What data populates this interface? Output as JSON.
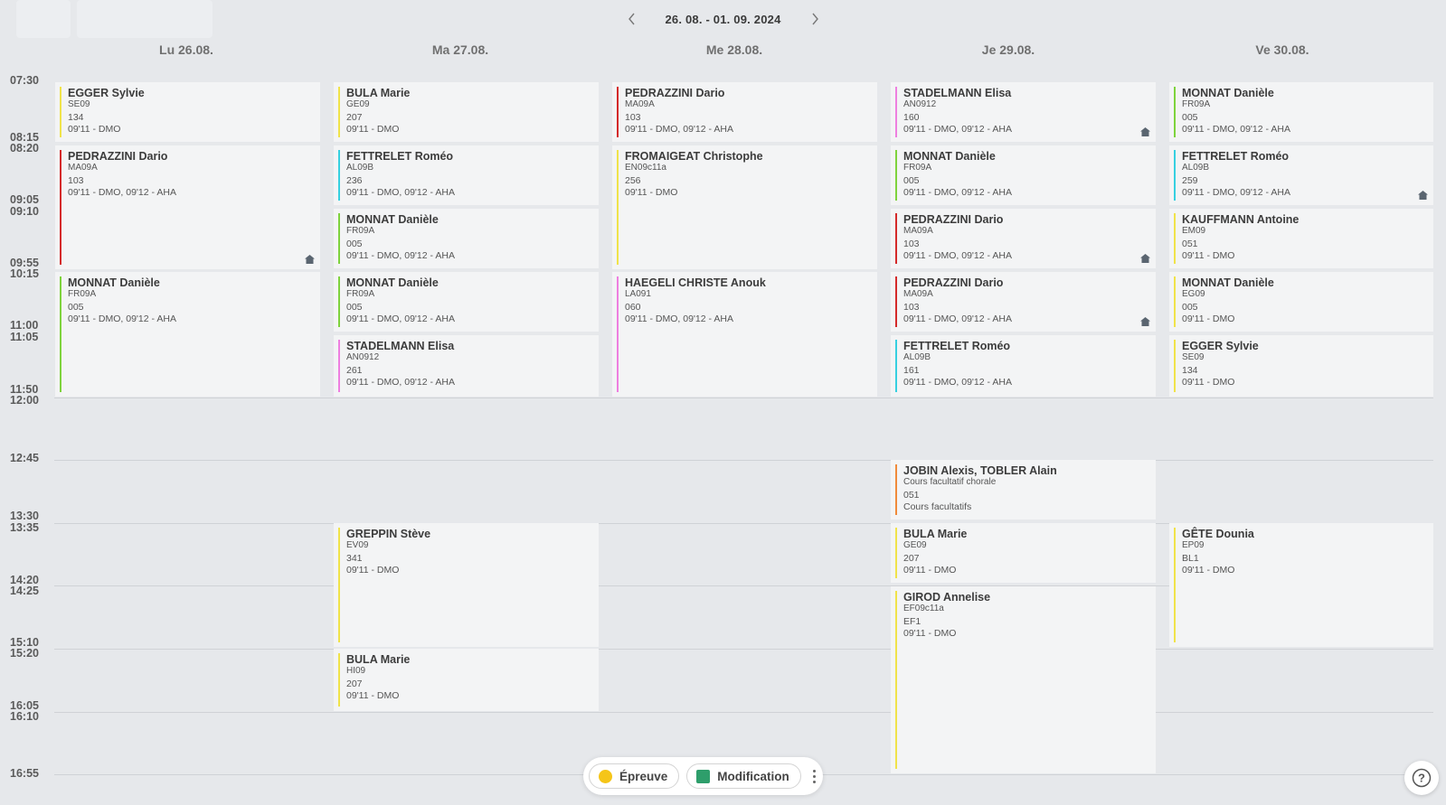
{
  "nav": {
    "date_range": "26. 08. - 01. 09. 2024",
    "prev_icon": "chevron-left-icon",
    "next_icon": "chevron-right-icon"
  },
  "days": [
    "Lu 26.08.",
    "Ma 27.08.",
    "Me 28.08.",
    "Je 29.08.",
    "Ve 30.08."
  ],
  "times": [
    "07:30",
    "08:15",
    "08:20",
    "09:05",
    "09:10",
    "09:55",
    "10:15",
    "11:00",
    "11:05",
    "11:50",
    "12:00",
    "12:45",
    "13:30",
    "13:35",
    "14:20",
    "14:25",
    "15:10",
    "15:20",
    "16:05",
    "16:10",
    "16:55"
  ],
  "colors": {
    "yellow": "#f0e34a",
    "red": "#d42a2a",
    "cyan": "#36d0e0",
    "green": "#7ed33d",
    "pink": "#ee7fe0",
    "orange": "#f08a3a"
  },
  "cards": [
    {
      "name": "EGGER Sylvie",
      "class": "SE09",
      "room": "134",
      "desc": "09'11 - DMO"
    },
    {
      "name": "PEDRAZZINI Dario",
      "class": "MA09A",
      "room": "103",
      "desc": "09'11 - DMO, 09'12 - AHA"
    },
    {
      "name": "MONNAT Danièle",
      "class": "FR09A",
      "room": "005",
      "desc": "09'11 - DMO, 09'12 - AHA"
    },
    {
      "name": "BULA Marie",
      "class": "GE09",
      "room": "207",
      "desc": "09'11 - DMO"
    },
    {
      "name": "FETTRELET Roméo",
      "class": "AL09B",
      "room": "236",
      "desc": "09'11 - DMO, 09'12 - AHA"
    },
    {
      "name": "MONNAT Danièle",
      "class": "FR09A",
      "room": "005",
      "desc": "09'11 - DMO, 09'12 - AHA"
    },
    {
      "name": "MONNAT Danièle",
      "class": "FR09A",
      "room": "005",
      "desc": "09'11 - DMO, 09'12 - AHA"
    },
    {
      "name": "STADELMANN Elisa",
      "class": "AN0912",
      "room": "261",
      "desc": "09'11 - DMO, 09'12 - AHA"
    },
    {
      "name": "GREPPIN Stève",
      "class": "EV09",
      "room": "341",
      "desc": "09'11 - DMO"
    },
    {
      "name": "BULA Marie",
      "class": "HI09",
      "room": "207",
      "desc": "09'11 - DMO"
    },
    {
      "name": "PEDRAZZINI Dario",
      "class": "MA09A",
      "room": "103",
      "desc": "09'11 - DMO, 09'12 - AHA"
    },
    {
      "name": "FROMAIGEAT Christophe",
      "class": "EN09c11a",
      "room": "256",
      "desc": "09'11 - DMO"
    },
    {
      "name": "HAEGELI CHRISTE Anouk",
      "class": "LA091",
      "room": "060",
      "desc": "09'11 - DMO, 09'12 - AHA"
    },
    {
      "name": "STADELMANN Elisa",
      "class": "AN0912",
      "room": "160",
      "desc": "09'11 - DMO, 09'12 - AHA"
    },
    {
      "name": "MONNAT Danièle",
      "class": "FR09A",
      "room": "005",
      "desc": "09'11 - DMO, 09'12 - AHA"
    },
    {
      "name": "PEDRAZZINI Dario",
      "class": "MA09A",
      "room": "103",
      "desc": "09'11 - DMO, 09'12 - AHA"
    },
    {
      "name": "PEDRAZZINI Dario",
      "class": "MA09A",
      "room": "103",
      "desc": "09'11 - DMO, 09'12 - AHA"
    },
    {
      "name": "FETTRELET Roméo",
      "class": "AL09B",
      "room": "161",
      "desc": "09'11 - DMO, 09'12 - AHA"
    },
    {
      "name": "JOBIN Alexis, TOBLER Alain",
      "class": "Cours facultatif chorale",
      "room": "051",
      "desc": "Cours facultatifs"
    },
    {
      "name": "BULA Marie",
      "class": "GE09",
      "room": "207",
      "desc": "09'11 - DMO"
    },
    {
      "name": "GIROD Annelise",
      "class": "EF09c11a",
      "room": "EF1",
      "desc": "09'11 - DMO"
    },
    {
      "name": "MONNAT Danièle",
      "class": "FR09A",
      "room": "005",
      "desc": "09'11 - DMO, 09'12 - AHA"
    },
    {
      "name": "FETTRELET Roméo",
      "class": "AL09B",
      "room": "259",
      "desc": "09'11 - DMO, 09'12 - AHA"
    },
    {
      "name": "KAUFFMANN Antoine",
      "class": "EM09",
      "room": "051",
      "desc": "09'11 - DMO"
    },
    {
      "name": "MONNAT Danièle",
      "class": "EG09",
      "room": "005",
      "desc": "09'11 - DMO"
    },
    {
      "name": "EGGER Sylvie",
      "class": "SE09",
      "room": "134",
      "desc": "09'11 - DMO"
    },
    {
      "name": "GÊTE Dounia",
      "class": "EP09",
      "room": "BL1",
      "desc": "09'11 - DMO"
    }
  ],
  "legend": {
    "epreuve_label": "Épreuve",
    "modification_label": "Modification",
    "epreuve_color": "#f5c518",
    "modification_color": "#2e9e6b"
  },
  "help": {
    "icon": "question-icon",
    "label": "?"
  }
}
